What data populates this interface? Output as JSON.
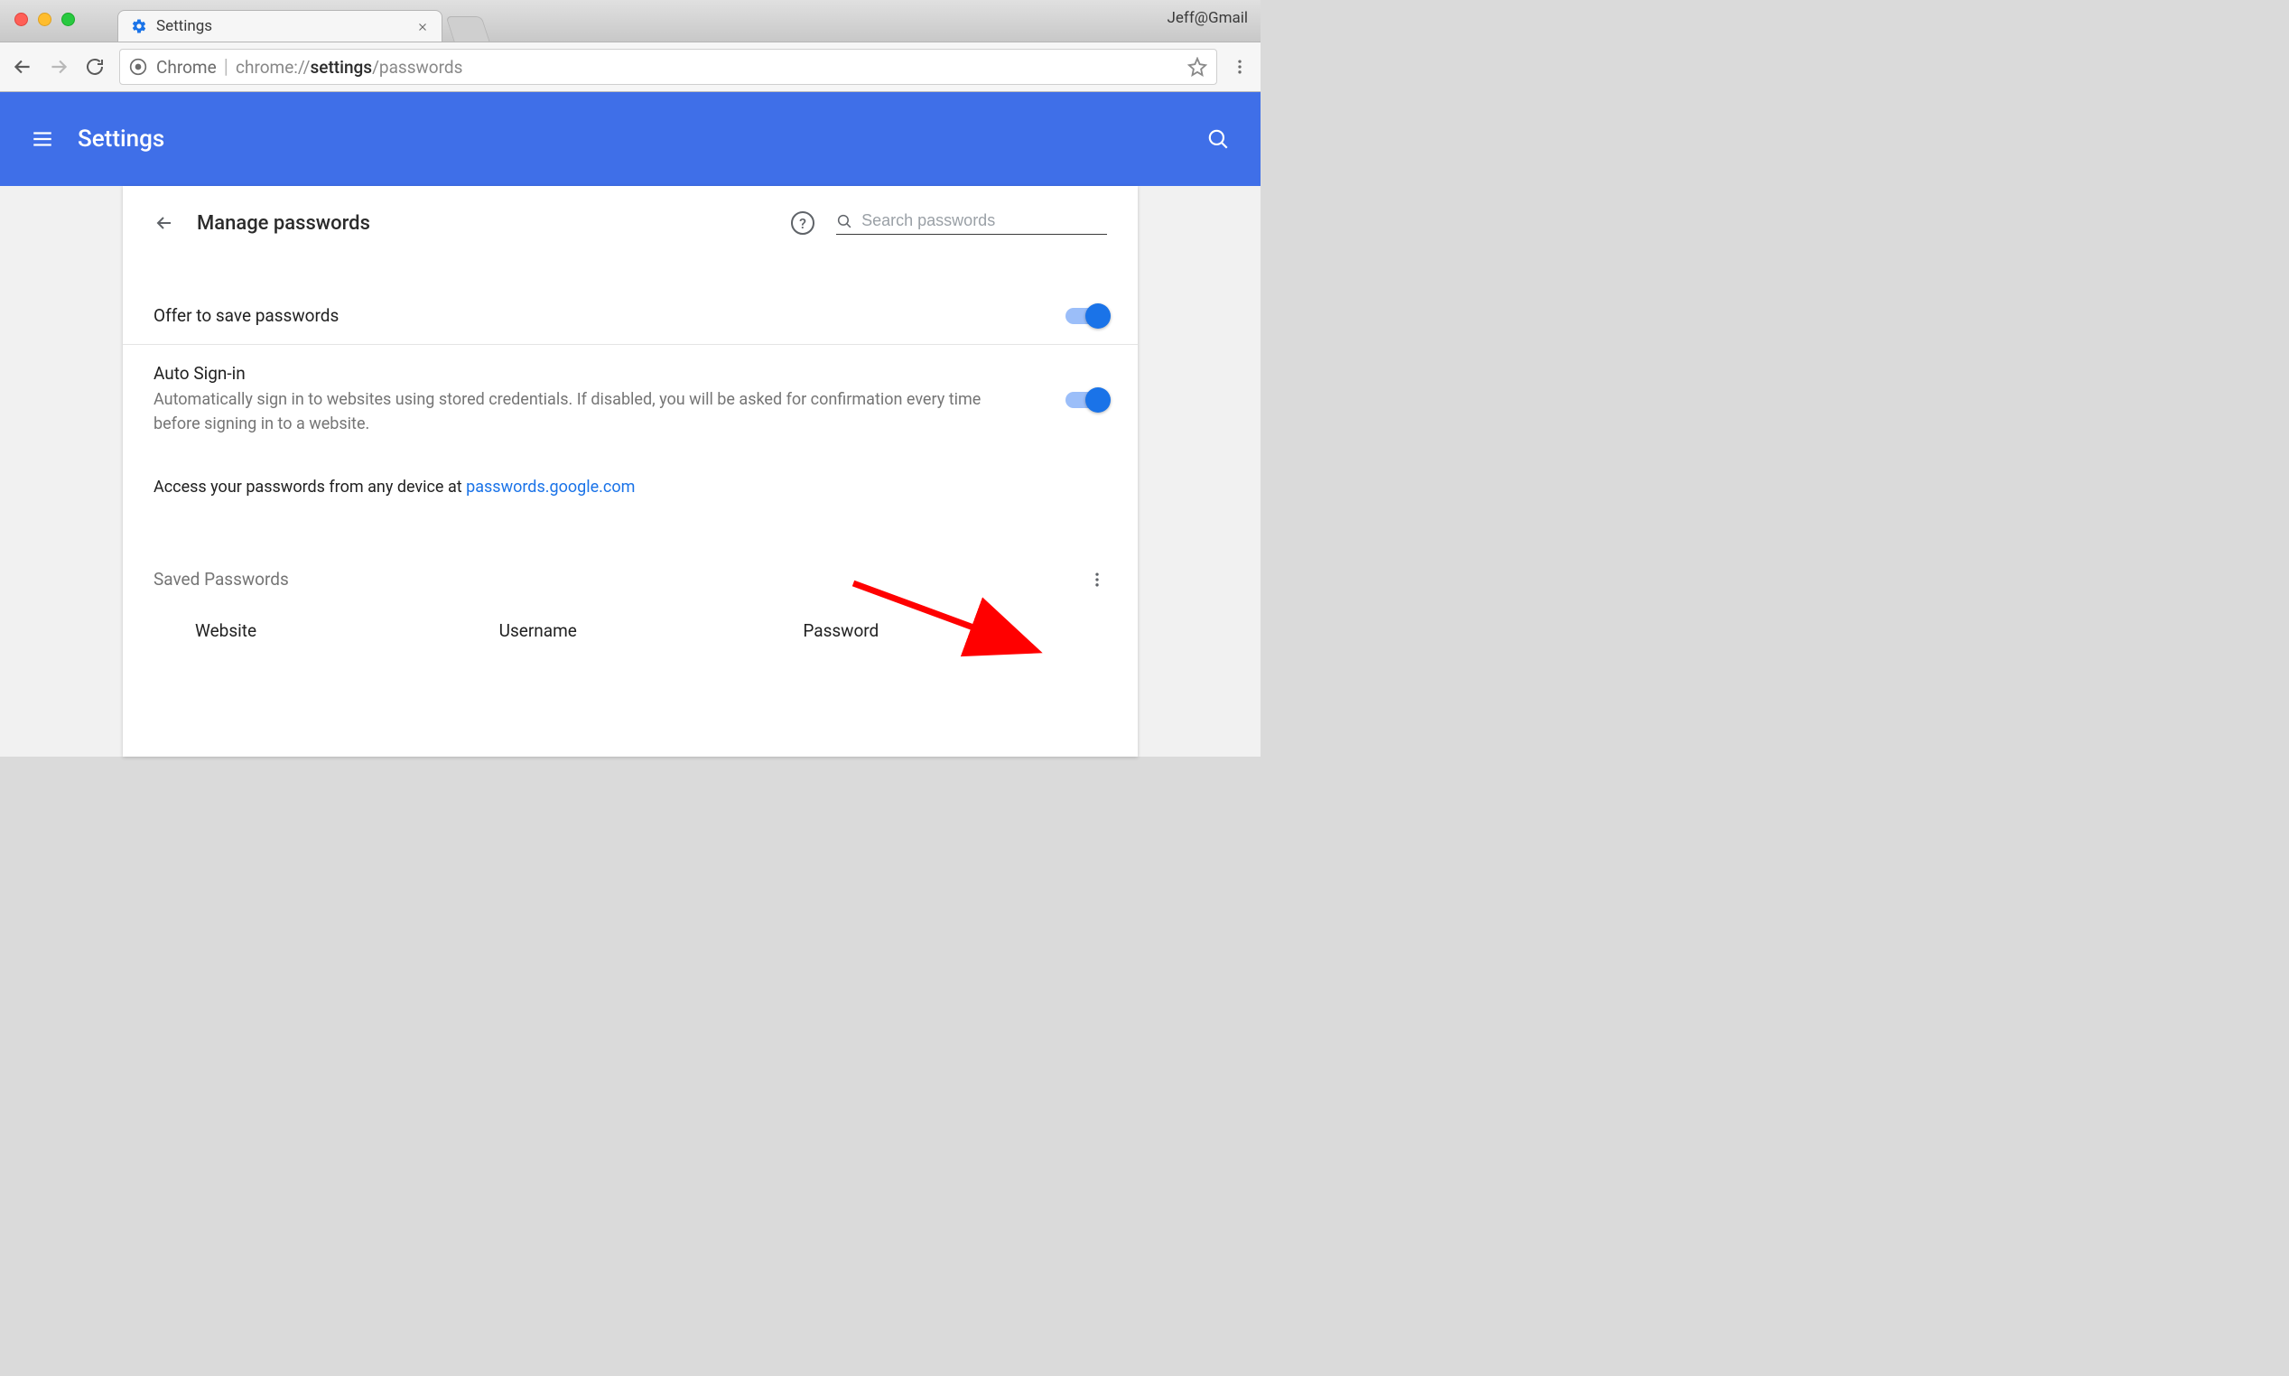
{
  "window": {
    "profile_label": "Jeff@Gmail"
  },
  "tab": {
    "title": "Settings"
  },
  "omnibox": {
    "scheme_label": "Chrome",
    "url_prefix": "chrome://",
    "url_bold": "settings",
    "url_suffix": "/passwords"
  },
  "header": {
    "title": "Settings"
  },
  "page": {
    "title": "Manage passwords",
    "search_placeholder": "Search passwords",
    "offer_label": "Offer to save passwords",
    "offer_on": true,
    "autosignin_label": "Auto Sign-in",
    "autosignin_desc": "Automatically sign in to websites using stored credentials. If disabled, you will be asked for confirmation every time before signing in to a website.",
    "autosignin_on": true,
    "access_prefix": "Access your passwords from any device at ",
    "access_link": "passwords.google.com",
    "saved_label": "Saved Passwords",
    "columns": {
      "website": "Website",
      "username": "Username",
      "password": "Password"
    }
  }
}
